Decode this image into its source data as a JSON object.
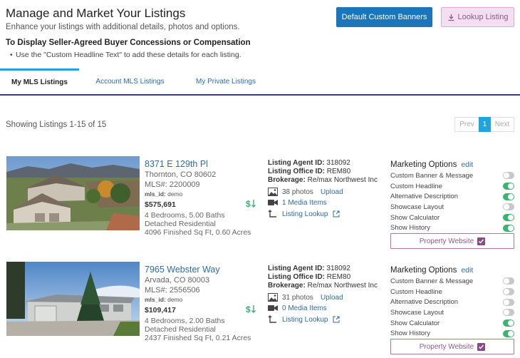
{
  "header": {
    "title": "Manage and Market Your Listings",
    "subtitle": "Enhance your listings with additional details, photos and options.",
    "notice_title": "To Display Seller-Agreed Buyer Concessions or Compensation",
    "notice_bullet": "Use the \"Custom Headline Text\" to add these details for each listing."
  },
  "buttons": {
    "default_banners": "Default Custom Banners",
    "lookup_listing": "Lookup Listing"
  },
  "tabs": [
    {
      "label": "My MLS Listings",
      "active": true
    },
    {
      "label": "Account MLS Listings",
      "active": false
    },
    {
      "label": "My Private Listings",
      "active": false
    }
  ],
  "showing_text": "Showing Listings 1-15 of 15",
  "pager": {
    "prev": "Prev",
    "current": "1",
    "next": "Next"
  },
  "labels": {
    "agent_id": "Listing Agent ID:",
    "office_id": "Listing Office ID:",
    "brokerage": "Brokerage:",
    "upload": "Upload",
    "listing_lookup": "Listing Lookup",
    "marketing_options": "Marketing Options",
    "edit": "edit",
    "property_website": "Property Website",
    "mls_id_label": "mls_id:"
  },
  "colors": {
    "accent_blue": "#1a75bb",
    "toggle_on": "#3cb371",
    "toggle_off": "#c8c8c8",
    "purple": "#8a5a88"
  },
  "listings": [
    {
      "address": "8371 E 129th Pl",
      "city": "Thornton, CO 80602",
      "mls": "MLS#: 2200009",
      "mls_id": "demo",
      "price": "$575,691",
      "beds_baths": "4 Bedrooms, 5.00 Baths",
      "type": "Detached Residential",
      "sqft": "4096 Finished Sq Ft, 0.60 Acres",
      "agent_id": "318092",
      "office_id": "REM80",
      "brokerage": "Re/max Northwest Inc",
      "photos": "38 photos",
      "media": "1 Media Items",
      "options": [
        {
          "label": "Custom Banner & Message",
          "on": false
        },
        {
          "label": "Custom Headline",
          "on": true
        },
        {
          "label": "Alternative Description",
          "on": true
        },
        {
          "label": "Showcase Layout",
          "on": false
        },
        {
          "label": "Show Calculator",
          "on": true
        },
        {
          "label": "Show History",
          "on": true
        }
      ]
    },
    {
      "address": "7965 Webster Way",
      "city": "Arvada, CO 80003",
      "mls": "MLS#: 2556506",
      "mls_id": "demo",
      "price": "$109,417",
      "beds_baths": "4 Bedrooms, 2.00 Baths",
      "type": "Detached Residential",
      "sqft": "2437 Finished Sq Ft, 0.21 Acres",
      "agent_id": "318092",
      "office_id": "REM80",
      "brokerage": "Re/max Northwest Inc",
      "photos": "31 photos",
      "media": "0 Media Items",
      "options": [
        {
          "label": "Custom Banner & Message",
          "on": false
        },
        {
          "label": "Custom Headline",
          "on": false
        },
        {
          "label": "Alternative Description",
          "on": false
        },
        {
          "label": "Showcase Layout",
          "on": false
        },
        {
          "label": "Show Calculator",
          "on": true
        },
        {
          "label": "Show History",
          "on": true
        }
      ]
    }
  ]
}
